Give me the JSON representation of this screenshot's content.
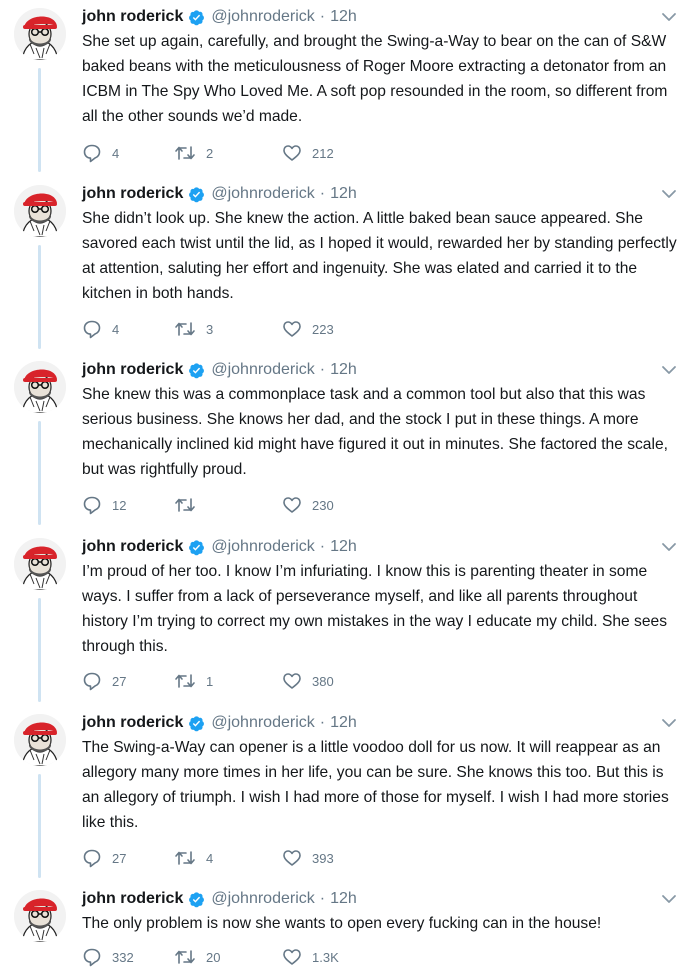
{
  "author": {
    "name": "john roderick",
    "handle": "@johnroderick"
  },
  "colors": {
    "text": "#14171a",
    "secondary": "#657786",
    "verified": "#1da1f2",
    "thread_line": "#cfe3f2",
    "avatar_hat": "#d8232a"
  },
  "icons": {
    "verified": "verified-badge-icon",
    "menu": "chevron-down-icon",
    "reply": "reply-icon",
    "retweet": "retweet-icon",
    "like": "heart-icon"
  },
  "tweets": [
    {
      "time": "12h",
      "text": "She set up again, carefully, and brought the Swing-a-Way to bear on the can of S&W baked beans with the meticulousness of Roger Moore extracting a detonator from an ICBM in The Spy Who Loved Me. A soft pop resounded in the room, so different from all the other sounds we’d made.",
      "replies": "4",
      "retweets": "2",
      "likes": "212"
    },
    {
      "time": "12h",
      "text": "She didn’t look up. She knew the action. A little baked bean sauce appeared. She savored each twist until the lid, as I hoped it would, rewarded her by standing perfectly at attention, saluting her effort and ingenuity. She was elated and carried it to the kitchen in both hands.",
      "replies": "4",
      "retweets": "3",
      "likes": "223"
    },
    {
      "time": "12h",
      "text": "She knew this was a commonplace task and a common tool but also that this was serious business. She knows her dad, and the stock I put in these things. A more mechanically inclined kid might have figured it out in minutes. She factored the scale, but was rightfully proud.",
      "replies": "12",
      "retweets": "",
      "likes": "230"
    },
    {
      "time": "12h",
      "text": "I’m proud of her too. I know I’m infuriating. I know this is parenting theater in some ways. I suffer from a lack of perseverance myself, and like all parents throughout history I’m trying to correct my own mistakes in the way I educate my child. She sees through this.",
      "replies": "27",
      "retweets": "1",
      "likes": "380"
    },
    {
      "time": "12h",
      "text": "The Swing-a-Way can opener is a little voodoo doll for us now. It will reappear as an allegory many more times in her life, you can be sure. She knows this too. But this is an allegory of triumph. I wish I had more of those for myself. I wish I had more stories like this.",
      "replies": "27",
      "retweets": "4",
      "likes": "393"
    },
    {
      "time": "12h",
      "text": "The only problem is now she wants to open every fucking can in the house!",
      "replies": "332",
      "retweets": "20",
      "likes": "1.3K"
    }
  ]
}
